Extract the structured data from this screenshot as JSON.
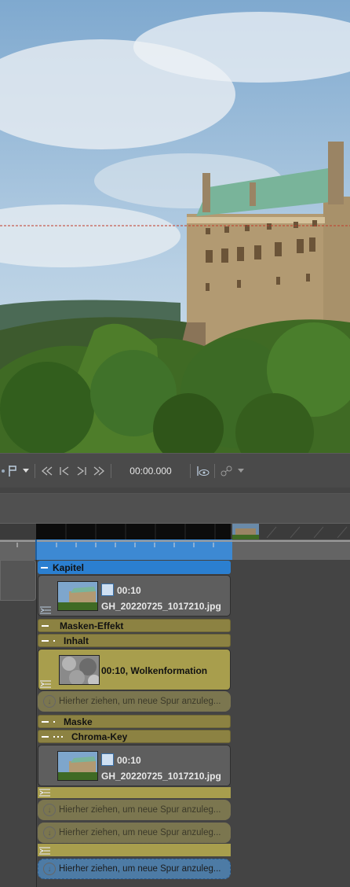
{
  "toolbar": {
    "timecode": "00:00.000",
    "icons": [
      "marker-icon",
      "dropdown-icon",
      "rewind-icon",
      "prev-frame-icon",
      "next-frame-icon",
      "fast-forward-icon",
      "eye-icon",
      "effects-icon",
      "dropdown-icon"
    ]
  },
  "tracks": {
    "kapitel_label": "Kapitel",
    "clip1": {
      "duration": "00:10",
      "filename": "GH_20220725_1017210.jpg"
    },
    "masken_effekt_label": "Masken-Effekt",
    "inhalt_label": "Inhalt",
    "clip2": {
      "caption": "00:10, Wolkenformation"
    },
    "drop_hint": "Hierher ziehen, um neue Spur anzuleg...",
    "maske_label": "Maske",
    "chroma_key_label": "Chroma-Key",
    "clip3": {
      "duration": "00:10",
      "filename": "GH_20220725_1017210.jpg"
    }
  },
  "colors": {
    "chapter_header": "#2b7fd0",
    "effect_track": "#a89e4d",
    "selection_blue": "#2b7fd0"
  }
}
